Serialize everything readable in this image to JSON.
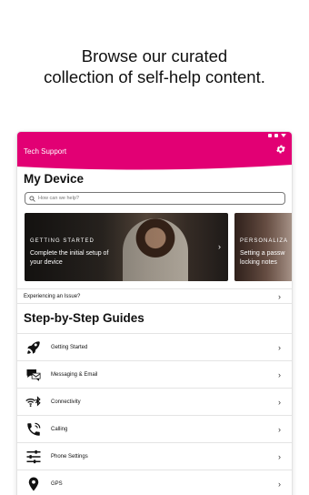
{
  "promo": {
    "line1": "Browse our curated",
    "line2": "collection of self-help content."
  },
  "app": {
    "title": "Tech Support",
    "brand_color": "#e20074",
    "settings_icon": "gear-icon"
  },
  "my_device": {
    "title": "My Device",
    "search_placeholder": "How can we help?",
    "cards": [
      {
        "kicker": "GETTING STARTED",
        "description": "Complete the initial setup of your device"
      },
      {
        "kicker": "PERSONALIZA",
        "description": "Setting a passw locking notes"
      }
    ],
    "issue_label": "Experiencing an Issue?"
  },
  "guides": {
    "title": "Step-by-Step Guides",
    "items": [
      {
        "label": "Getting Started",
        "icon": "rocket-icon"
      },
      {
        "label": "Messaging & Email",
        "icon": "messaging-icon"
      },
      {
        "label": "Connectivity",
        "icon": "wifi-bluetooth-icon"
      },
      {
        "label": "Calling",
        "icon": "phone-icon"
      },
      {
        "label": "Phone Settings",
        "icon": "sliders-icon"
      },
      {
        "label": "GPS",
        "icon": "location-pin-icon"
      }
    ]
  }
}
